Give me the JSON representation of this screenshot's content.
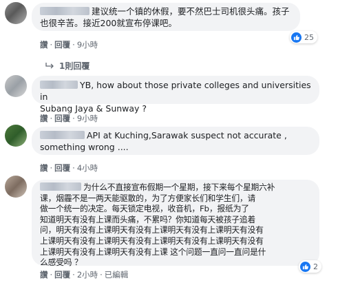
{
  "comments": [
    {
      "text_lines": [
        "建议统一个镇的休假，要不然巴士司机很头痛。孩子",
        "也很辛苦。接近200就宣布停课吧。"
      ],
      "actions": {
        "like": "讚",
        "reply": "回覆",
        "time": "9小時"
      },
      "reactions": {
        "icon": "like-icon",
        "count": "25"
      },
      "replies_label": "1則回覆"
    },
    {
      "text_lines": [
        "YB, how about those private colleges and universities in",
        "Subang Jaya & Sunway ?"
      ],
      "actions": {
        "like": "讚",
        "reply": "回覆",
        "time": "9小時"
      }
    },
    {
      "text_lines": [
        "API at Kuching,Sarawak suspect not accurate ,",
        "something wrong ...."
      ],
      "actions": {
        "like": "讚",
        "reply": "回覆",
        "time": "4小時"
      }
    },
    {
      "text_lines": [
        "为什么不直接宣布假期一个星期，接下来每个星期六补",
        "课，烟霾不是一两天能驱散的，为了方便家长们和学生们，请",
        "做一个统一的决定。每天锁定电视，收音机，Fb，报纸为了",
        "知道明天有没有上课而头痛，不累吗？你知道每天被孩子追着",
        "问，明天有没有上课明天有没有上课明天有没有上课明天有没有",
        "上课明天有没有上课明天有没有上课明天有没有上课明天有没有",
        "上课明天有没有上课明天有没有上课 这个问题一直问一直问是什",
        "么感受吗 ？"
      ],
      "actions": {
        "like": "讚",
        "reply": "回覆",
        "time": "2小時",
        "edited": "已編輯"
      },
      "reactions": {
        "icon": "like-icon",
        "count": "2"
      }
    }
  ],
  "colors": {
    "bubble": "#f2f3f5",
    "like_blue": "#1877f2",
    "meta_gray": "#606770"
  }
}
